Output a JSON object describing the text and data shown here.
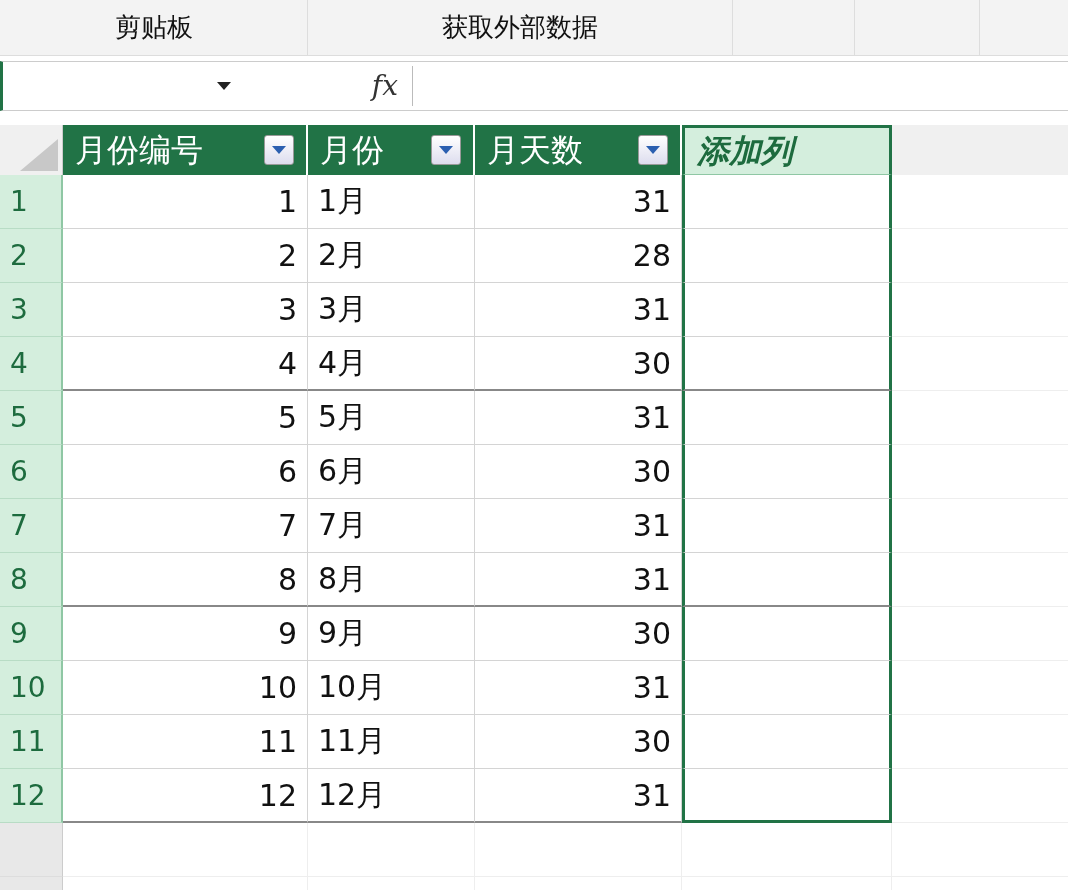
{
  "ribbon": {
    "groups": [
      "剪贴板",
      "获取外部数据"
    ]
  },
  "formula_bar": {
    "fx_label": "fx"
  },
  "table": {
    "columns": [
      {
        "label": "月份编号",
        "kind": "number",
        "filter": true,
        "selected": false
      },
      {
        "label": "月份",
        "kind": "text",
        "filter": true,
        "selected": false
      },
      {
        "label": "月天数",
        "kind": "number",
        "filter": true,
        "selected": false
      },
      {
        "label": "添加列",
        "kind": "empty",
        "filter": false,
        "selected": true
      }
    ],
    "rows": [
      {
        "number": "1",
        "cells": [
          "1",
          "1月",
          "31"
        ]
      },
      {
        "number": "2",
        "cells": [
          "2",
          "2月",
          "28"
        ]
      },
      {
        "number": "3",
        "cells": [
          "3",
          "3月",
          "31"
        ]
      },
      {
        "number": "4",
        "cells": [
          "4",
          "4月",
          "30"
        ]
      },
      {
        "number": "5",
        "cells": [
          "5",
          "5月",
          "31"
        ]
      },
      {
        "number": "6",
        "cells": [
          "6",
          "6月",
          "30"
        ]
      },
      {
        "number": "7",
        "cells": [
          "7",
          "7月",
          "31"
        ]
      },
      {
        "number": "8",
        "cells": [
          "8",
          "8月",
          "31"
        ]
      },
      {
        "number": "9",
        "cells": [
          "9",
          "9月",
          "30"
        ]
      },
      {
        "number": "10",
        "cells": [
          "10",
          "10月",
          "31"
        ]
      },
      {
        "number": "11",
        "cells": [
          "11",
          "11月",
          "30"
        ]
      },
      {
        "number": "12",
        "cells": [
          "12",
          "12月",
          "31"
        ]
      }
    ]
  }
}
